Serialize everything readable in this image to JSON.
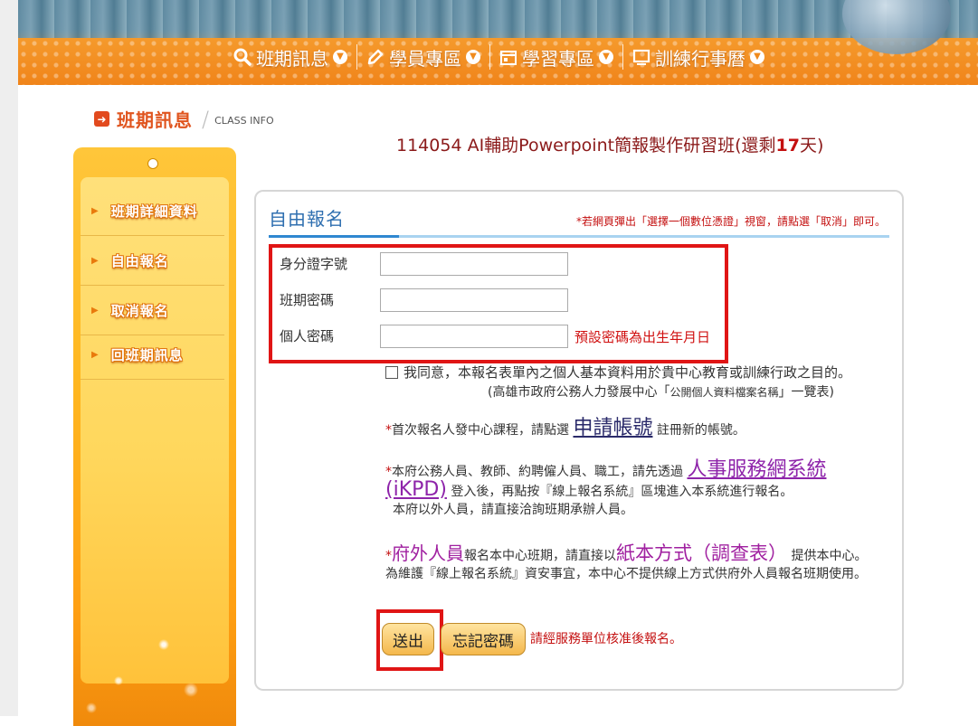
{
  "nav": {
    "items": [
      {
        "label": "班期訊息",
        "icon": "search-icon"
      },
      {
        "label": "學員專區",
        "icon": "pencil-icon"
      },
      {
        "label": "學習專區",
        "icon": "calendar-icon"
      },
      {
        "label": "訓練行事曆",
        "icon": "screen-icon"
      }
    ]
  },
  "section": {
    "title": "班期訊息",
    "subtitle": "CLASS INFO"
  },
  "class_title": {
    "prefix": "114054 AI輔助Powerpoint簡報製作研習班(還剩",
    "days": "17",
    "suffix": "天)"
  },
  "sidebar": {
    "items": [
      {
        "label": "班期詳細資料"
      },
      {
        "label": "自由報名"
      },
      {
        "label": "取消報名"
      },
      {
        "label": "回班期訊息"
      }
    ]
  },
  "form": {
    "tab_title": "自由報名",
    "notice": "*若網頁彈出「選擇一個數位憑證」視窗，請點選「取消」即可。",
    "fields": [
      {
        "label": "身分證字號",
        "value": ""
      },
      {
        "label": "班期密碼",
        "value": ""
      },
      {
        "label": "個人密碼",
        "value": ""
      }
    ],
    "password_hint": "預設密碼為出生年月日",
    "agree_text": "我同意，本報名表單內之個人基本資料用於貴中心教育或訓練行政之目的。",
    "agree_source_a": "(高雄市政府公務人力發展中心「",
    "agree_source_b": "公開個人資料檔案名稱",
    "agree_source_c": "」一覽表)",
    "first_time_a": "首次報名人發中心課程，請點選",
    "first_time_link": "申請帳號",
    "first_time_b": "註冊新的帳號。",
    "staff_a": "本府公務人員、教師、約聘僱人員、職工，請先透過",
    "staff_link": "人事服務網系統(iKPD)",
    "staff_b": "登入後，再點按『線上報名系統』區塊進入本系統進行報名。",
    "staff_c": "本府以外人員，請直接洽詢班期承辦人員。",
    "outside_title": "府外人員",
    "outside_a": "報名本中心班期，請直接以",
    "outside_method": "紙本方式（調查表）",
    "outside_b": "提供本中心。為維護『線上報名系統』資安事宜，本中心不提供線上方式供府外人員報名班期使用。",
    "submit_label": "送出",
    "forgot_label": "忘記密碼",
    "button_note": "請經服務單位核准後報名。"
  }
}
